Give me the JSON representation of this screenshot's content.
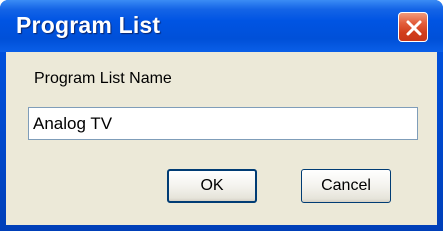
{
  "window": {
    "title": "Program List"
  },
  "form": {
    "label": "Program List Name",
    "value": "Analog TV"
  },
  "buttons": {
    "ok_label": "OK",
    "cancel_label": "Cancel"
  },
  "icons": {
    "close": "close-icon"
  },
  "colors": {
    "titlebar": "#0054e3",
    "close_button": "#d13e1c",
    "client_background": "#ece9d8",
    "button_border": "#003c74"
  }
}
